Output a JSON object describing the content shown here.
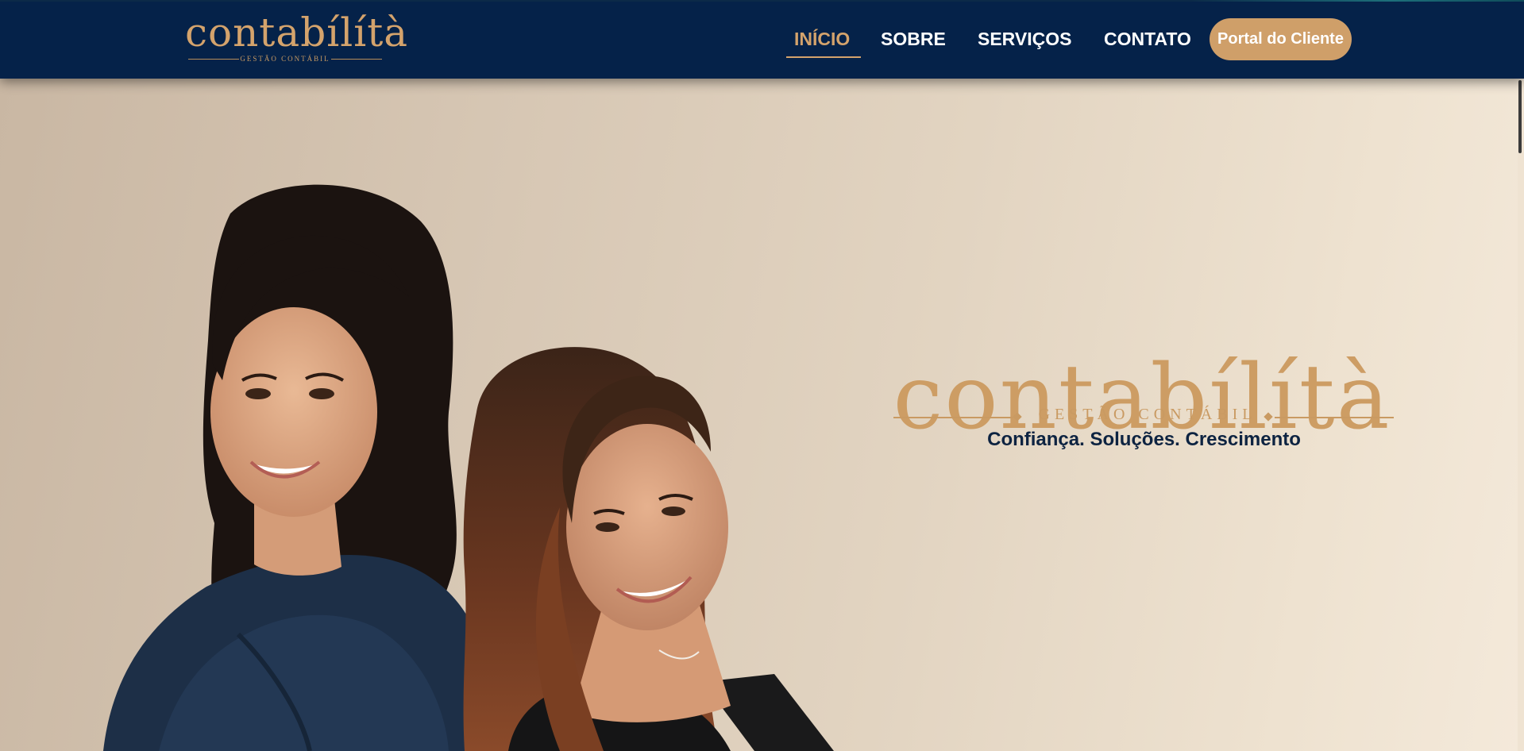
{
  "colors": {
    "navy": "#052249",
    "gold": "#d4a36c",
    "button_gold": "#cf9f69",
    "slogan_navy": "#0d2341"
  },
  "header": {
    "logo_word": "contabílítà",
    "logo_tagline": "GESTÃO CONTÁBIL",
    "nav": [
      {
        "label": "INÍCIO",
        "active": true
      },
      {
        "label": "SOBRE",
        "active": false
      },
      {
        "label": "SERVIÇOS",
        "active": false
      },
      {
        "label": "CONTATO",
        "active": false
      }
    ],
    "portal_button": "Portal do Cliente"
  },
  "hero": {
    "title": "contabílítà",
    "subtitle": "GESTÃO CONTÁBIL",
    "slogan": "Confiança. Soluções. Crescimento",
    "image": "two-women-portrait-photo"
  }
}
